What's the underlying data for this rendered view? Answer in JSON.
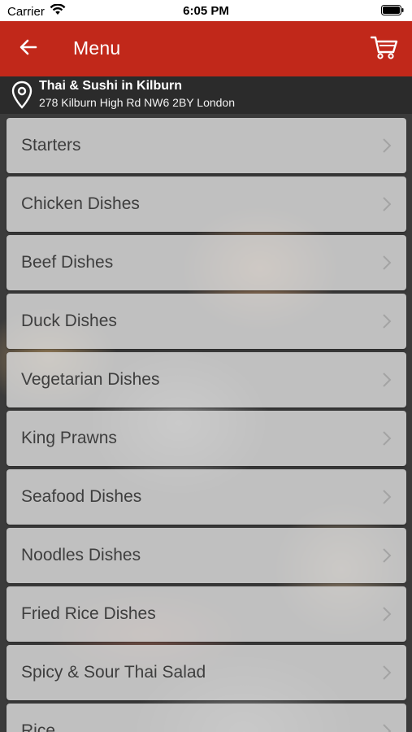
{
  "status_bar": {
    "carrier": "Carrier",
    "time": "6:05 PM",
    "icons": [
      "wifi-icon",
      "battery-icon"
    ]
  },
  "header": {
    "title": "Menu",
    "back_icon": "arrow-left-icon",
    "cart_icon": "cart-icon",
    "color": "#c1281a"
  },
  "location": {
    "icon": "location-pin-icon",
    "name": "Thai & Sushi in Kilburn",
    "address": "278 Kilburn High Rd NW6 2BY London"
  },
  "menu": {
    "items": [
      {
        "label": "Starters"
      },
      {
        "label": "Chicken Dishes"
      },
      {
        "label": "Beef Dishes"
      },
      {
        "label": "Duck Dishes"
      },
      {
        "label": "Vegetarian Dishes"
      },
      {
        "label": "King Prawns"
      },
      {
        "label": "Seafood Dishes"
      },
      {
        "label": "Noodles Dishes"
      },
      {
        "label": "Fried Rice Dishes"
      },
      {
        "label": "Spicy & Sour Thai Salad"
      },
      {
        "label": "Rice"
      }
    ],
    "chevron_icon": "chevron-right-icon"
  }
}
